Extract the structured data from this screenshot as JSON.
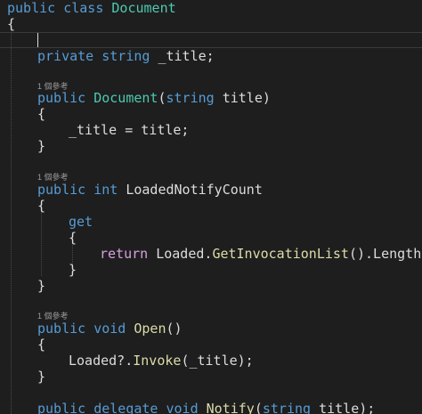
{
  "code": {
    "class_decl": {
      "kw1": "public",
      "kw2": "class",
      "name": "Document"
    },
    "brace_open": "{",
    "field": {
      "kw1": "private",
      "kw2": "string",
      "rest": "_title;"
    },
    "ctor": {
      "codelens": "1 個參考",
      "kw": "public",
      "name": "Document",
      "paren_open": "(",
      "param_type": "string",
      "param_rest": "title)",
      "open": "{",
      "body": "_title = title;",
      "close": "}"
    },
    "prop": {
      "codelens": "1 個參考",
      "kw1": "public",
      "kw2": "int",
      "name": "LoadedNotifyCount",
      "open": "{",
      "get": "get",
      "get_open": "{",
      "ret_kw": "return",
      "ret_a": "Loaded.",
      "ret_fn": "GetInvocationList",
      "ret_b": "().Length;",
      "get_close": "}",
      "close": "}"
    },
    "open_method": {
      "codelens": "1 個參考",
      "kw1": "public",
      "kw2": "void",
      "name": "Open",
      "parens": "()",
      "open": "{",
      "body_a": "Loaded?.",
      "body_fn": "Invoke",
      "body_b": "(_title);",
      "close": "}"
    },
    "delegate": {
      "kw1": "public",
      "kw2": "delegate",
      "kw3": "void",
      "name": "Notify",
      "paren_open": "(",
      "param_type": "string",
      "param_rest": "title);"
    }
  },
  "colors": {
    "background": "#1e1e1e",
    "keyword": "#569cd6",
    "type": "#4ec9b0",
    "method": "#dcdcaa",
    "text": "#dcdcdc",
    "control_keyword": "#d8a0df",
    "codelens": "#999999"
  }
}
